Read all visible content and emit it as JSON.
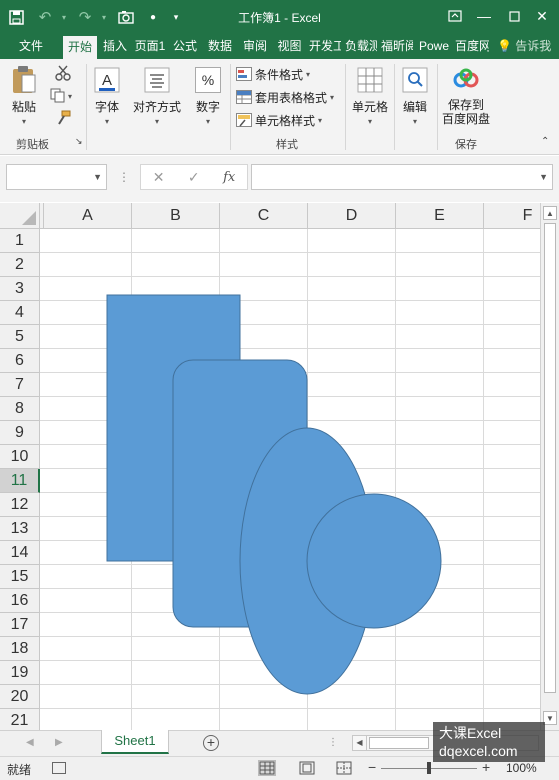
{
  "window": {
    "title": "工作簿1 - Excel"
  },
  "ribbon_tabs": [
    {
      "label": "文件",
      "active": false
    },
    {
      "label": "开始",
      "active": true
    },
    {
      "label": "插入",
      "active": false
    },
    {
      "label": "页面1",
      "active": false
    },
    {
      "label": "公式",
      "active": false
    },
    {
      "label": "数据",
      "active": false
    },
    {
      "label": "审阅",
      "active": false
    },
    {
      "label": "视图",
      "active": false
    },
    {
      "label": "开发工",
      "active": false
    },
    {
      "label": "负载测",
      "active": false
    },
    {
      "label": "福昕阅",
      "active": false
    },
    {
      "label": "Powe",
      "active": false
    },
    {
      "label": "百度网",
      "active": false
    }
  ],
  "tell_me": "告诉我",
  "ribbon": {
    "clipboard": {
      "paste": "粘贴",
      "group": "剪贴板"
    },
    "font": {
      "label": "字体"
    },
    "alignment": {
      "label": "对齐方式"
    },
    "number": {
      "label": "数字",
      "icon_text": "%"
    },
    "styles": {
      "group": "样式",
      "conditional": "条件格式",
      "table": "套用表格格式",
      "cell_styles": "单元格样式"
    },
    "cells": {
      "label": "单元格"
    },
    "editing": {
      "label": "编辑"
    },
    "save": {
      "line1": "保存到",
      "line2": "百度网盘",
      "group": "保存"
    }
  },
  "formula_bar": {
    "name_box": "",
    "formula": "",
    "fx": "fx"
  },
  "columns": [
    "A",
    "B",
    "C",
    "D",
    "E",
    "F"
  ],
  "rows": [
    "1",
    "2",
    "3",
    "4",
    "5",
    "6",
    "7",
    "8",
    "9",
    "10",
    "11",
    "12",
    "13",
    "14",
    "15",
    "16",
    "17",
    "18",
    "19",
    "20",
    "21"
  ],
  "selected_row": "11",
  "shape_color": "#5b9bd5",
  "shape_border": "#41719c",
  "sheet_tabs": [
    "Sheet1"
  ],
  "status": {
    "mode": "就绪",
    "zoom": "100%"
  },
  "watermark": {
    "line1": "大课Excel",
    "line2": "dqexcel.com"
  }
}
